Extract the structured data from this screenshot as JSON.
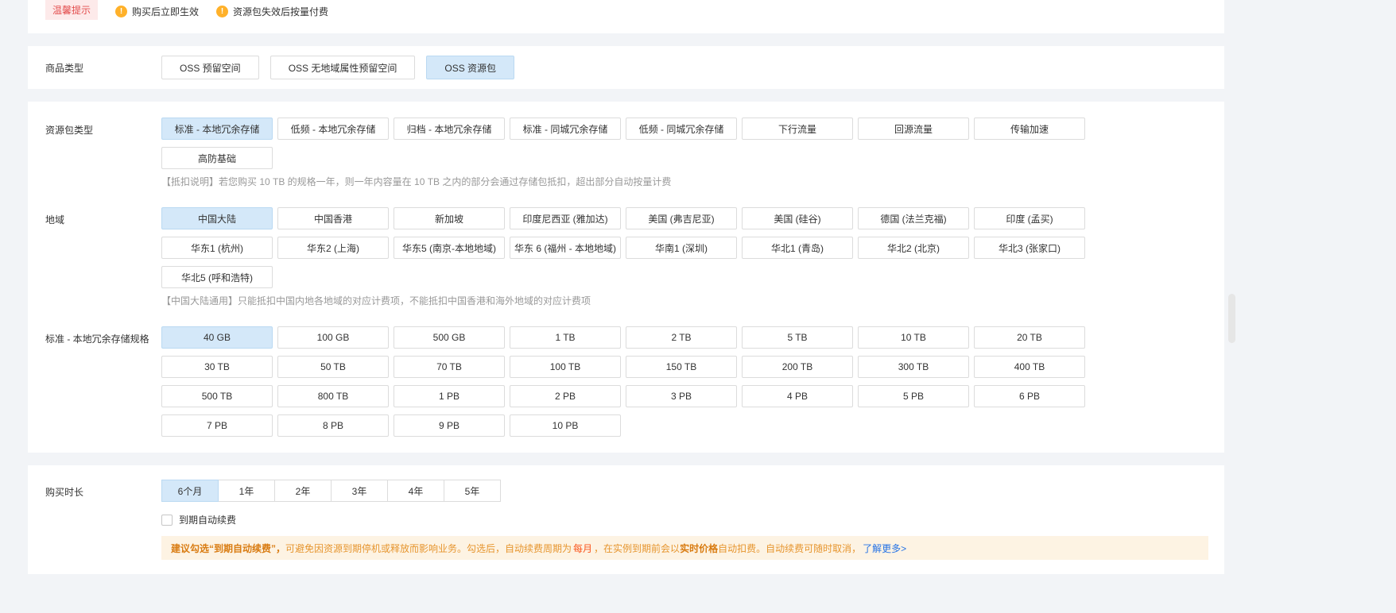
{
  "tips_bar": {
    "badge": "温馨提示",
    "items": [
      {
        "icon": "notice-icon",
        "text": "购买后立即生效"
      },
      {
        "icon": "notice-icon",
        "text": "资源包失效后按量付费"
      }
    ]
  },
  "product_type": {
    "label": "商品类型",
    "options": [
      {
        "label": "OSS 预留空间",
        "selected": false
      },
      {
        "label": "OSS 无地域属性预留空间",
        "selected": false
      },
      {
        "label": "OSS 资源包",
        "selected": true
      }
    ]
  },
  "package_type": {
    "label": "资源包类型",
    "options": [
      {
        "label": "标准 - 本地冗余存储",
        "selected": true
      },
      {
        "label": "低频 - 本地冗余存储",
        "selected": false
      },
      {
        "label": "归档 - 本地冗余存储",
        "selected": false
      },
      {
        "label": "标准 - 同城冗余存储",
        "selected": false
      },
      {
        "label": "低频 - 同城冗余存储",
        "selected": false
      },
      {
        "label": "下行流量",
        "selected": false
      },
      {
        "label": "回源流量",
        "selected": false
      },
      {
        "label": "传输加速",
        "selected": false
      },
      {
        "label": "高防基础",
        "selected": false
      }
    ],
    "note": "【抵扣说明】若您购买 10 TB 的规格一年，则一年内容量在 10 TB 之内的部分会通过存储包抵扣，超出部分自动按量计费"
  },
  "region": {
    "label": "地域",
    "options": [
      {
        "label": "中国大陆",
        "selected": true
      },
      {
        "label": "中国香港",
        "selected": false
      },
      {
        "label": "新加坡",
        "selected": false
      },
      {
        "label": "印度尼西亚 (雅加达)",
        "selected": false
      },
      {
        "label": "美国 (弗吉尼亚)",
        "selected": false
      },
      {
        "label": "美国 (硅谷)",
        "selected": false
      },
      {
        "label": "德国 (法兰克福)",
        "selected": false
      },
      {
        "label": "印度 (孟买)",
        "selected": false
      },
      {
        "label": "华东1 (杭州)",
        "selected": false
      },
      {
        "label": "华东2 (上海)",
        "selected": false
      },
      {
        "label": "华东5 (南京-本地地域)",
        "selected": false
      },
      {
        "label": "华东 6 (福州 - 本地地域)",
        "selected": false
      },
      {
        "label": "华南1 (深圳)",
        "selected": false
      },
      {
        "label": "华北1 (青岛)",
        "selected": false
      },
      {
        "label": "华北2 (北京)",
        "selected": false
      },
      {
        "label": "华北3 (张家口)",
        "selected": false
      },
      {
        "label": "华北5 (呼和浩特)",
        "selected": false
      }
    ],
    "note": "【中国大陆通用】只能抵扣中国内地各地域的对应计费项，不能抵扣中国香港和海外地域的对应计费项"
  },
  "spec": {
    "label": "标准 - 本地冗余存储规格",
    "options": [
      {
        "label": "40 GB",
        "selected": true
      },
      {
        "label": "100 GB",
        "selected": false
      },
      {
        "label": "500 GB",
        "selected": false
      },
      {
        "label": "1 TB",
        "selected": false
      },
      {
        "label": "2 TB",
        "selected": false
      },
      {
        "label": "5 TB",
        "selected": false
      },
      {
        "label": "10 TB",
        "selected": false
      },
      {
        "label": "20 TB",
        "selected": false
      },
      {
        "label": "30 TB",
        "selected": false
      },
      {
        "label": "50 TB",
        "selected": false
      },
      {
        "label": "70 TB",
        "selected": false
      },
      {
        "label": "100 TB",
        "selected": false
      },
      {
        "label": "150 TB",
        "selected": false
      },
      {
        "label": "200 TB",
        "selected": false
      },
      {
        "label": "300 TB",
        "selected": false
      },
      {
        "label": "400 TB",
        "selected": false
      },
      {
        "label": "500 TB",
        "selected": false
      },
      {
        "label": "800 TB",
        "selected": false
      },
      {
        "label": "1 PB",
        "selected": false
      },
      {
        "label": "2 PB",
        "selected": false
      },
      {
        "label": "3 PB",
        "selected": false
      },
      {
        "label": "4 PB",
        "selected": false
      },
      {
        "label": "5 PB",
        "selected": false
      },
      {
        "label": "6 PB",
        "selected": false
      },
      {
        "label": "7 PB",
        "selected": false
      },
      {
        "label": "8 PB",
        "selected": false
      },
      {
        "label": "9 PB",
        "selected": false
      },
      {
        "label": "10 PB",
        "selected": false
      }
    ]
  },
  "duration": {
    "label": "购买时长",
    "options": [
      {
        "label": "6个月",
        "selected": true
      },
      {
        "label": "1年",
        "selected": false
      },
      {
        "label": "2年",
        "selected": false
      },
      {
        "label": "3年",
        "selected": false
      },
      {
        "label": "4年",
        "selected": false
      },
      {
        "label": "5年",
        "selected": false
      }
    ],
    "auto_renew_label": "到期自动续费",
    "auto_renew_checked": false,
    "notice": {
      "bold_prefix": "建议勾选“到期自动续费”，",
      "text1": "可避免因资源到期停机或释放而影响业务。勾选后，自动续费周期为 ",
      "cycle": "每月",
      "text2": "，在实例到期前会以",
      "bold2": "实时价格",
      "text3": "自动扣费。自动续费可随时取消，",
      "link": "了解更多>"
    }
  },
  "colors": {
    "selected_bg": "#d4e8f9",
    "selected_border": "#bad9f2",
    "notice_bg": "#fdf3e3",
    "notice_text": "#e6952e",
    "link": "#2673e5",
    "badge_bg": "#fdeaea",
    "badge_text": "#e34d4d"
  }
}
